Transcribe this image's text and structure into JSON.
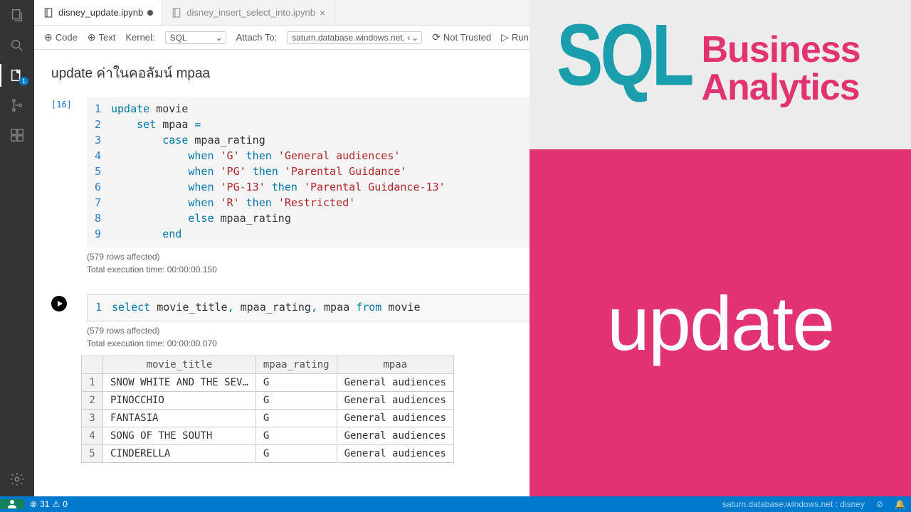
{
  "tabs": [
    {
      "label": "disney_update.ipynb",
      "modified": true
    },
    {
      "label": "disney_insert_select_into.ipynb",
      "modified": false
    }
  ],
  "toolbar": {
    "code": "Code",
    "text": "Text",
    "kernel_label": "Kernel:",
    "kernel_value": "SQL",
    "attach_label": "Attach To:",
    "attach_value": "saturn.database.windows.net, ‹",
    "trusted": "Not Trusted",
    "run": "Run"
  },
  "section_title": "update ค่าในคอลัมน์ mpaa",
  "cell1": {
    "prompt": "[16]",
    "lines": [
      [
        {
          "c": "kw",
          "t": "update"
        },
        {
          "c": "plain",
          "t": " movie"
        }
      ],
      [
        {
          "c": "plain",
          "t": "    "
        },
        {
          "c": "kw",
          "t": "set"
        },
        {
          "c": "plain",
          "t": " mpaa "
        },
        {
          "c": "kw",
          "t": "="
        }
      ],
      [
        {
          "c": "plain",
          "t": "        "
        },
        {
          "c": "kw",
          "t": "case"
        },
        {
          "c": "plain",
          "t": " mpaa_rating"
        }
      ],
      [
        {
          "c": "plain",
          "t": "            "
        },
        {
          "c": "kw",
          "t": "when"
        },
        {
          "c": "plain",
          "t": " "
        },
        {
          "c": "str",
          "t": "'G'"
        },
        {
          "c": "plain",
          "t": " "
        },
        {
          "c": "kw",
          "t": "then"
        },
        {
          "c": "plain",
          "t": " "
        },
        {
          "c": "str",
          "t": "'General audiences'"
        }
      ],
      [
        {
          "c": "plain",
          "t": "            "
        },
        {
          "c": "kw",
          "t": "when"
        },
        {
          "c": "plain",
          "t": " "
        },
        {
          "c": "str",
          "t": "'PG'"
        },
        {
          "c": "plain",
          "t": " "
        },
        {
          "c": "kw",
          "t": "then"
        },
        {
          "c": "plain",
          "t": " "
        },
        {
          "c": "str",
          "t": "'Parental Guidance'"
        }
      ],
      [
        {
          "c": "plain",
          "t": "            "
        },
        {
          "c": "kw",
          "t": "when"
        },
        {
          "c": "plain",
          "t": " "
        },
        {
          "c": "str",
          "t": "'PG-13'"
        },
        {
          "c": "plain",
          "t": " "
        },
        {
          "c": "kw",
          "t": "then"
        },
        {
          "c": "plain",
          "t": " "
        },
        {
          "c": "str",
          "t": "'Parental Guidance-13'"
        }
      ],
      [
        {
          "c": "plain",
          "t": "            "
        },
        {
          "c": "kw",
          "t": "when"
        },
        {
          "c": "plain",
          "t": " "
        },
        {
          "c": "str",
          "t": "'R'"
        },
        {
          "c": "plain",
          "t": " "
        },
        {
          "c": "kw",
          "t": "then"
        },
        {
          "c": "plain",
          "t": " "
        },
        {
          "c": "str",
          "t": "'Restricted'"
        }
      ],
      [
        {
          "c": "plain",
          "t": "            "
        },
        {
          "c": "kw",
          "t": "else"
        },
        {
          "c": "plain",
          "t": " mpaa_rating"
        }
      ],
      [
        {
          "c": "plain",
          "t": "        "
        },
        {
          "c": "kw",
          "t": "end"
        }
      ]
    ],
    "rows_affected": "(579 rows affected)",
    "exec_time": "Total execution time: 00:00:00.150"
  },
  "cell2": {
    "line": [
      {
        "c": "kw",
        "t": "select"
      },
      {
        "c": "plain",
        "t": " movie_title"
      },
      {
        "c": "kw",
        "t": ","
      },
      {
        "c": "plain",
        "t": " mpaa_rating"
      },
      {
        "c": "kw",
        "t": ","
      },
      {
        "c": "plain",
        "t": " mpaa "
      },
      {
        "c": "kw",
        "t": "from"
      },
      {
        "c": "plain",
        "t": " movie"
      }
    ],
    "rows_affected": "(579 rows affected)",
    "exec_time": "Total execution time: 00:00:00.070",
    "columns": [
      "movie_title",
      "mpaa_rating",
      "mpaa"
    ],
    "rows": [
      {
        "n": "1",
        "title": "SNOW WHITE AND THE SEV…",
        "r": "G",
        "m": "General audiences"
      },
      {
        "n": "2",
        "title": "PINOCCHIO",
        "r": "G",
        "m": "General audiences"
      },
      {
        "n": "3",
        "title": "FANTASIA",
        "r": "G",
        "m": "General audiences"
      },
      {
        "n": "4",
        "title": "SONG OF THE SOUTH",
        "r": "G",
        "m": "General audiences"
      },
      {
        "n": "5",
        "title": "CINDERELLA",
        "r": "G",
        "m": "General audiences"
      }
    ]
  },
  "explorer_badge": "1",
  "status": {
    "errors": "31",
    "warnings": "0",
    "right": "saturn.database.windows.net : disney"
  },
  "promo": {
    "sql": "SQL",
    "l1": "Business",
    "l2": "Analytics",
    "big": "update"
  }
}
